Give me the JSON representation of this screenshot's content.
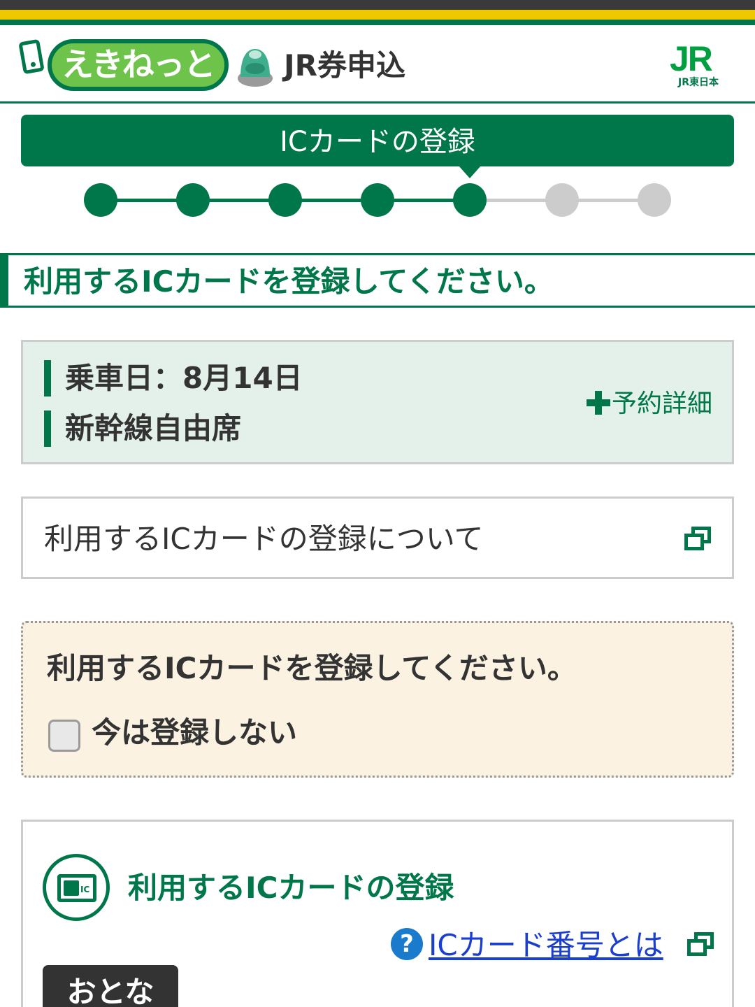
{
  "header": {
    "logo_text": "えきねっと",
    "title": "JR券申込",
    "jr_mark": "JR",
    "jr_sub": "JR東日本",
    "colors": {
      "brand_green": "#00774a",
      "logo_green": "#6ec44a",
      "stripe_yellow": "#f0c800"
    }
  },
  "step": {
    "banner": "ICカードの登録",
    "total": 7,
    "current": 5
  },
  "section_heading": "利用するICカードを登録してください。",
  "ride": {
    "date": "乗車日：8月14日",
    "seat": "新幹線自由席",
    "detail_link": "予約詳細"
  },
  "about": {
    "label": "利用するICカードの登録について",
    "icon": "external-link-icon"
  },
  "notice": {
    "text": "利用するICカードを登録してください。",
    "checkbox_label": "今は登録しない",
    "checkbox_checked": false
  },
  "ic_register": {
    "icon": "ic-card-icon",
    "icon_label": "IC",
    "title": "利用するICカードの登録",
    "help_mark": "?",
    "help_link": "ICカード番号とは",
    "tab_adult": "おとな"
  }
}
